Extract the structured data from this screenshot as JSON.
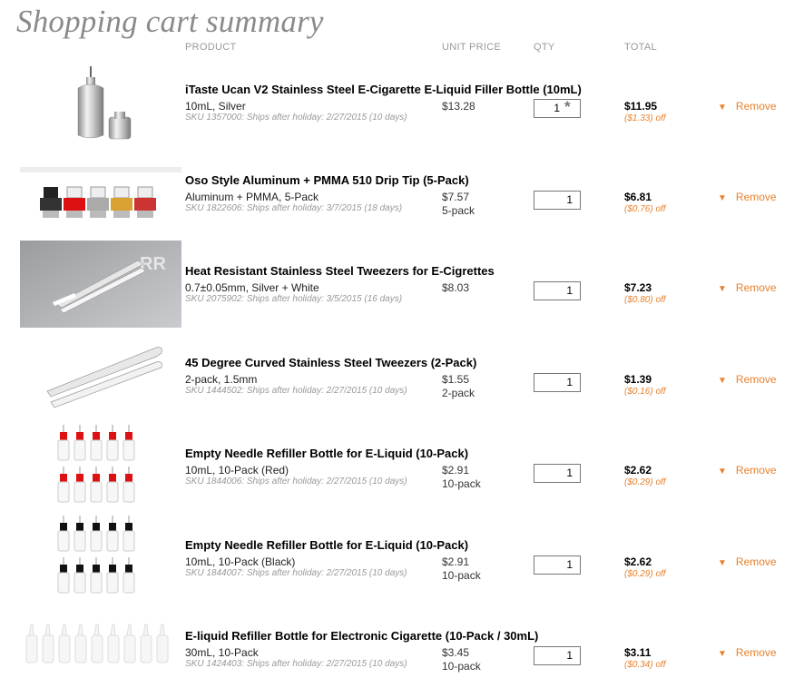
{
  "page": {
    "title": "Shopping cart summary"
  },
  "columns": {
    "product": "PRODUCT",
    "unit_price": "UNIT PRICE",
    "qty": "QTY",
    "total": "TOTAL"
  },
  "remove_label": "Remove",
  "colors": {
    "accent": "#e8812c",
    "title_gray": "#8a8a8a"
  },
  "items": [
    {
      "title": "iTaste Ucan V2 Stainless Steel E-Cigarette E-Liquid Filler Bottle (10mL)",
      "variant": "10mL, Silver",
      "sku": "SKU 1357000: Ships after holiday: 2/27/2015 (10 days)",
      "unit_price": "$13.28",
      "pack": "",
      "qty": "1",
      "total": "$11.95",
      "discount": "($1.33) off",
      "image": "silver-filler-bottle"
    },
    {
      "title": "Oso Style Aluminum + PMMA 510 Drip Tip (5-Pack)",
      "variant": "Aluminum + PMMA, 5-Pack",
      "sku": "SKU 1822606: Ships after holiday: 3/7/2015 (18 days)",
      "unit_price": "$7.57",
      "pack": "5-pack",
      "qty": "1",
      "total": "$6.81",
      "discount": "($0.76) off",
      "image": "drip-tips"
    },
    {
      "title": "Heat Resistant Stainless Steel Tweezers for E-Cigrettes",
      "variant": "0.7±0.05mm, Silver + White",
      "sku": "SKU 2075902: Ships after holiday: 3/5/2015 (16 days)",
      "unit_price": "$8.03",
      "pack": "",
      "qty": "1",
      "total": "$7.23",
      "discount": "($0.80) off",
      "image": "tweezers-gray"
    },
    {
      "title": "45 Degree Curved Stainless Steel Tweezers (2-Pack)",
      "variant": "2-pack, 1.5mm",
      "sku": "SKU 1444502: Ships after holiday: 2/27/2015 (10 days)",
      "unit_price": "$1.55",
      "pack": "2-pack",
      "qty": "1",
      "total": "$1.39",
      "discount": "($0.16) off",
      "image": "curved-tweezers"
    },
    {
      "title": "Empty Needle Refiller Bottle for E-Liquid (10-Pack)",
      "variant": "10mL, 10-Pack (Red)",
      "sku": "SKU 1844006: Ships after holiday: 2/27/2015 (10 days)",
      "unit_price": "$2.91",
      "pack": "10-pack",
      "qty": "1",
      "total": "$2.62",
      "discount": "($0.29) off",
      "image": "needle-bottles-red"
    },
    {
      "title": "Empty Needle Refiller Bottle for E-Liquid (10-Pack)",
      "variant": "10mL, 10-Pack (Black)",
      "sku": "SKU 1844007: Ships after holiday: 2/27/2015 (10 days)",
      "unit_price": "$2.91",
      "pack": "10-pack",
      "qty": "1",
      "total": "$2.62",
      "discount": "($0.29) off",
      "image": "needle-bottles-black"
    },
    {
      "title": "E-liquid Refiller Bottle for Electronic Cigarette (10-Pack / 30mL)",
      "variant": "30mL, 10-Pack",
      "sku": "SKU 1424403: Ships after holiday: 2/27/2015 (10 days)",
      "unit_price": "$3.45",
      "pack": "10-pack",
      "qty": "1",
      "total": "$3.11",
      "discount": "($0.34) off",
      "image": "clear-bottles"
    }
  ]
}
